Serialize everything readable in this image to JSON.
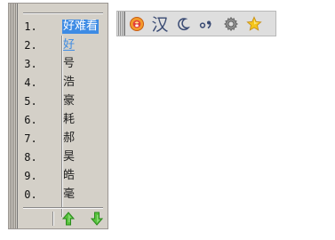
{
  "candidates": [
    {
      "index": "1.",
      "text": "好难看",
      "state": "selected"
    },
    {
      "index": "2.",
      "text": "好",
      "state": "highlight"
    },
    {
      "index": "3.",
      "text": "号",
      "state": "normal"
    },
    {
      "index": "4.",
      "text": "浩",
      "state": "normal"
    },
    {
      "index": "5.",
      "text": "豪",
      "state": "normal"
    },
    {
      "index": "6.",
      "text": "耗",
      "state": "normal"
    },
    {
      "index": "7.",
      "text": "郝",
      "state": "normal"
    },
    {
      "index": "8.",
      "text": "昊",
      "state": "normal"
    },
    {
      "index": "9.",
      "text": "皓",
      "state": "normal"
    },
    {
      "index": "0.",
      "text": "毫",
      "state": "normal"
    }
  ],
  "pager": {
    "prev_icon": "green-up-arrow-icon",
    "next_icon": "green-down-arrow-icon"
  },
  "toolbar": {
    "logo_icon": "ime-logo-icon",
    "language_mode": "汉",
    "width_icon": "crescent-moon-icon",
    "punctuation_icon": "chinese-punctuation-icon",
    "settings_icon": "gear-icon",
    "favorite_icon": "star-icon"
  },
  "colors": {
    "panel_bg": "#d4d0c8",
    "selection_bg": "#3d8be4",
    "highlight_text": "#3d8be4",
    "toolbar_bg": "#dedede",
    "arrow_green": "#3fae2a",
    "star_yellow": "#f2c31b"
  }
}
